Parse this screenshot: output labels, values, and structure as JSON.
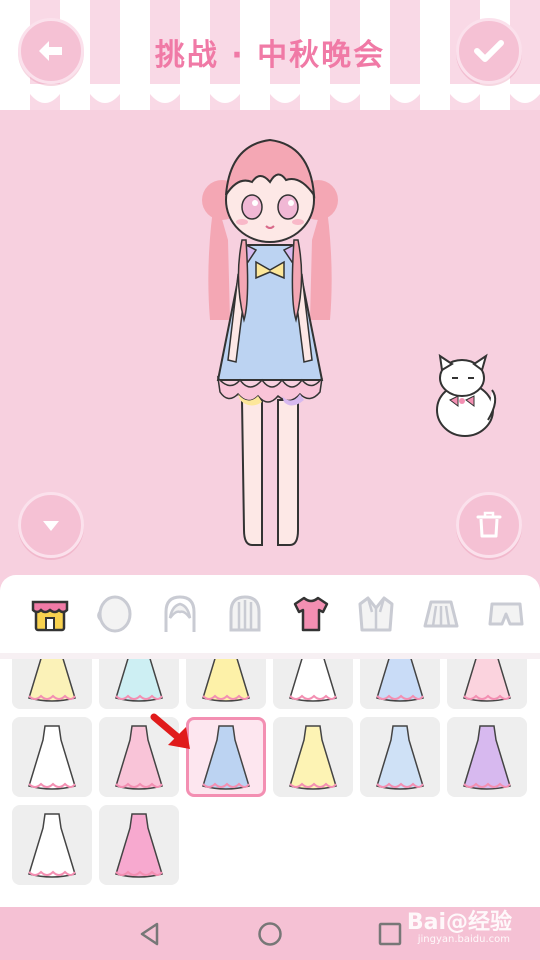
{
  "header": {
    "title": "挑战 · 中秋晚会",
    "back_icon": "arrow-left-icon",
    "confirm_icon": "check-icon"
  },
  "stage": {
    "collapse_icon": "chevron-down-icon",
    "trash_icon": "trash-icon",
    "character": "girl-in-blue-dress",
    "pet": "white-cat-with-pink-bow"
  },
  "categories": [
    {
      "name": "shop",
      "icon": "shop-icon",
      "active": false
    },
    {
      "name": "face",
      "icon": "face-icon",
      "active": false
    },
    {
      "name": "hair-front",
      "icon": "hair-icon",
      "active": false
    },
    {
      "name": "hair-back",
      "icon": "hair-back-icon",
      "active": false
    },
    {
      "name": "top",
      "icon": "tshirt-icon",
      "active": true
    },
    {
      "name": "coat",
      "icon": "coat-icon",
      "active": false
    },
    {
      "name": "skirt",
      "icon": "skirt-icon",
      "active": false
    },
    {
      "name": "pants",
      "icon": "shorts-icon",
      "active": false
    }
  ],
  "dresses": [
    {
      "id": "dress-1",
      "color": "#fbf2b8",
      "style": "sundress",
      "selected": false
    },
    {
      "id": "dress-2",
      "color": "#cdeff3",
      "style": "sundress",
      "selected": false
    },
    {
      "id": "dress-3",
      "color": "#fdf1a8",
      "style": "shift",
      "selected": false
    },
    {
      "id": "dress-4",
      "color": "#ffffff",
      "style": "slip",
      "selected": false
    },
    {
      "id": "dress-5",
      "color": "#c9dcf7",
      "style": "bow-dress",
      "selected": false
    },
    {
      "id": "dress-6",
      "color": "#fbd3de",
      "style": "coat-dress",
      "selected": false
    },
    {
      "id": "dress-7",
      "color": "#ffffff",
      "style": "puff-sleeve",
      "selected": false
    },
    {
      "id": "dress-8",
      "color": "#f9c4d8",
      "style": "ball-gown",
      "selected": false
    },
    {
      "id": "dress-9",
      "color": "#bcd3f2",
      "style": "nightgown",
      "selected": true
    },
    {
      "id": "dress-10",
      "color": "#fdf3b4",
      "style": "qipao",
      "selected": false
    },
    {
      "id": "dress-11",
      "color": "#cfe1f6",
      "style": "long-sleeve",
      "selected": false
    },
    {
      "id": "dress-12",
      "color": "#d7b9ef",
      "style": "gradient-gown",
      "selected": false
    },
    {
      "id": "dress-13",
      "color": "#ffffff",
      "style": "wedding-gown",
      "selected": false
    },
    {
      "id": "dress-14",
      "color": "#f7a9cf",
      "style": "mermaid-gown",
      "selected": false
    }
  ],
  "navigation": {
    "back_icon": "triangle-back-icon",
    "home_icon": "circle-home-icon",
    "recents_icon": "square-recents-icon"
  },
  "watermark": {
    "brand": "Bai@经验",
    "url": "jingyan.baidu.com"
  }
}
